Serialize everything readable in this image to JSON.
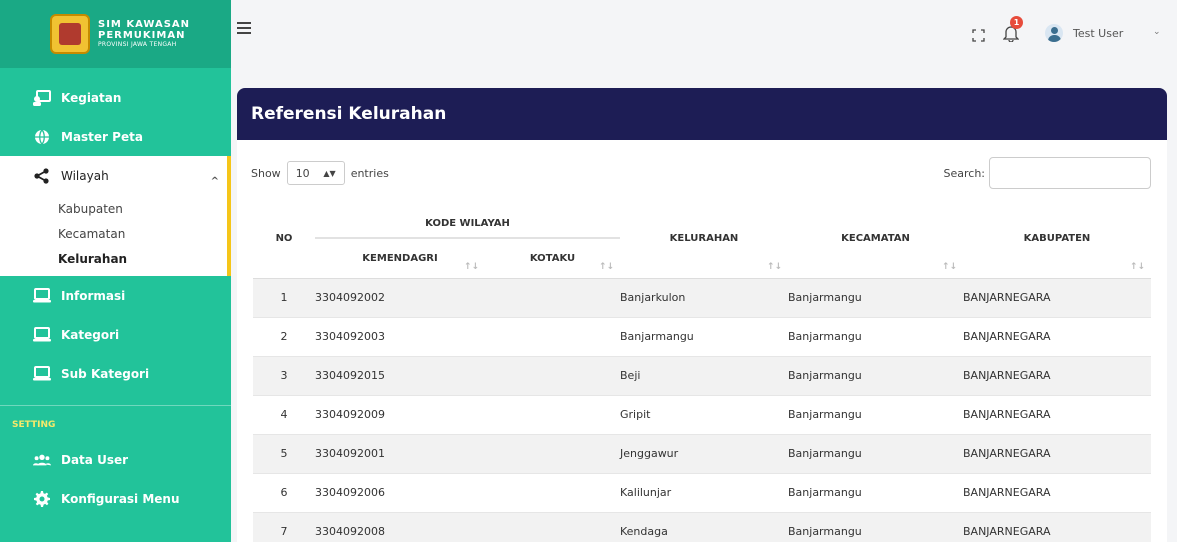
{
  "brand": {
    "line1": "SIM KAWASAN",
    "line2": "PERMUKIMAN",
    "line3": "PROVINSI JAWA TENGAH"
  },
  "sidebar": {
    "items": [
      {
        "label": "Kegiatan",
        "icon": "presentation-icon"
      },
      {
        "label": "Master Peta",
        "icon": "globe-icon"
      },
      {
        "label": "Wilayah",
        "icon": "share-icon"
      },
      {
        "label": "Informasi",
        "icon": "laptop-icon"
      },
      {
        "label": "Kategori",
        "icon": "laptop-icon"
      },
      {
        "label": "Sub Kategori",
        "icon": "laptop-icon"
      }
    ],
    "submenu": [
      "Kabupaten",
      "Kecamatan",
      "Kelurahan"
    ],
    "section_label": "SETTING",
    "setting_items": [
      {
        "label": "Data User",
        "icon": "users-icon"
      },
      {
        "label": "Konfigurasi Menu",
        "icon": "gear-icon"
      }
    ]
  },
  "topbar": {
    "user_name": "Test User",
    "notification_count": "1"
  },
  "card": {
    "title": "Referensi Kelurahan"
  },
  "table_controls": {
    "show": "Show",
    "length": "10",
    "entries": "entries",
    "search_label": "Search:",
    "search_value": ""
  },
  "table": {
    "headers": {
      "no": "NO",
      "kode_wilayah": "KODE WILAYAH",
      "kemendagri": "KEMENDAGRI",
      "kotaku": "KOTAKU",
      "kelurahan": "KELURAHAN",
      "kecamatan": "KECAMATAN",
      "kabupaten": "KABUPATEN"
    },
    "rows": [
      {
        "no": "1",
        "kemendagri": "3304092002",
        "kotaku": "",
        "kelurahan": "Banjarkulon",
        "kecamatan": "Banjarmangu",
        "kabupaten": "BANJARNEGARA"
      },
      {
        "no": "2",
        "kemendagri": "3304092003",
        "kotaku": "",
        "kelurahan": "Banjarmangu",
        "kecamatan": "Banjarmangu",
        "kabupaten": "BANJARNEGARA"
      },
      {
        "no": "3",
        "kemendagri": "3304092015",
        "kotaku": "",
        "kelurahan": "Beji",
        "kecamatan": "Banjarmangu",
        "kabupaten": "BANJARNEGARA"
      },
      {
        "no": "4",
        "kemendagri": "3304092009",
        "kotaku": "",
        "kelurahan": "Gripit",
        "kecamatan": "Banjarmangu",
        "kabupaten": "BANJARNEGARA"
      },
      {
        "no": "5",
        "kemendagri": "3304092001",
        "kotaku": "",
        "kelurahan": "Jenggawur",
        "kecamatan": "Banjarmangu",
        "kabupaten": "BANJARNEGARA"
      },
      {
        "no": "6",
        "kemendagri": "3304092006",
        "kotaku": "",
        "kelurahan": "Kalilunjar",
        "kecamatan": "Banjarmangu",
        "kabupaten": "BANJARNEGARA"
      },
      {
        "no": "7",
        "kemendagri": "3304092008",
        "kotaku": "",
        "kelurahan": "Kendaga",
        "kecamatan": "Banjarmangu",
        "kabupaten": "BANJARNEGARA"
      }
    ]
  },
  "colors": {
    "sidebar": "#22c39a",
    "header": "#1d1d55",
    "active_indicator": "#f5c518",
    "badge": "#e74c3c"
  }
}
